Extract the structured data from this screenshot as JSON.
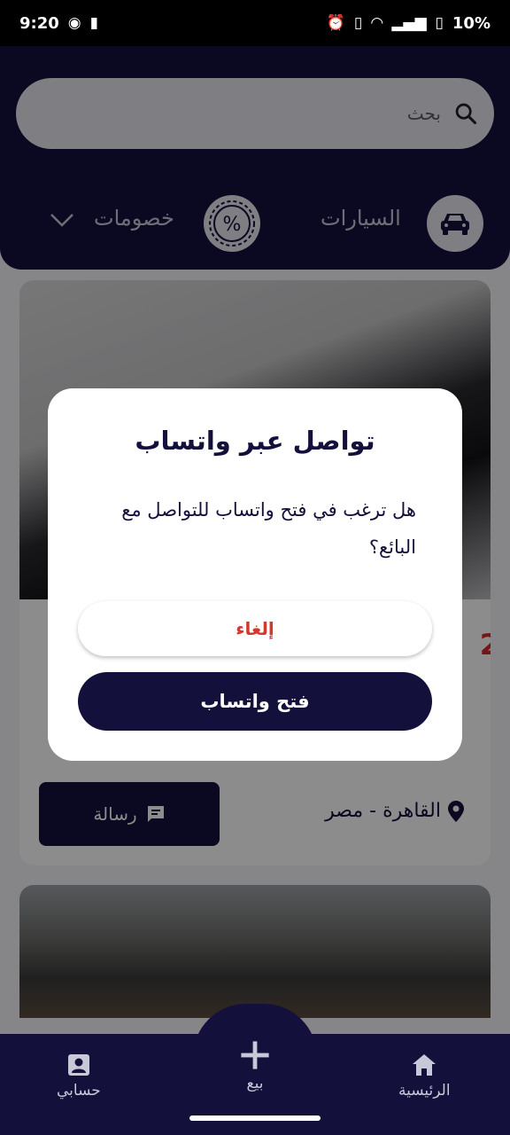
{
  "status_bar": {
    "time": "9:20",
    "battery": "10%"
  },
  "search": {
    "placeholder": "بحث"
  },
  "categories": [
    {
      "label": "السيارات",
      "icon": "car-icon"
    },
    {
      "label": "خصومات",
      "icon": "percent-badge-icon"
    }
  ],
  "listing": {
    "price_fragment": "2",
    "location": "القاهرة - مصر",
    "message_label": "رسالة"
  },
  "dialog": {
    "title": "تواصل عبر واتساب",
    "body": "هل ترغب في فتح واتساب للتواصل مع البائع؟",
    "cancel_label": "إلغاء",
    "confirm_label": "فتح واتساب"
  },
  "bottom_nav": {
    "account_label": "حسابي",
    "sell_label": "بيع",
    "home_label": "الرئيسية"
  },
  "colors": {
    "primary": "#14103c",
    "danger": "#d33a2c",
    "price": "#d52b2b"
  }
}
